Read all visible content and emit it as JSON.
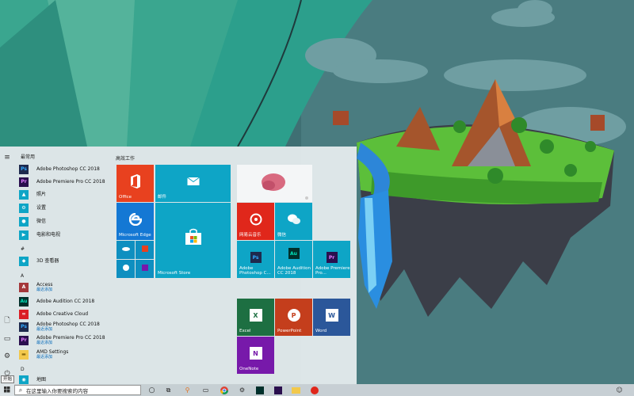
{
  "start_menu": {
    "sections": {
      "recent": "最常用",
      "hash": "#",
      "a": "A",
      "d": "D"
    },
    "recent_apps": [
      {
        "label": "Adobe Photoshop CC 2018",
        "icon": "photoshop-icon"
      },
      {
        "label": "Adobe Premiere Pro CC 2018",
        "icon": "premiere-icon"
      },
      {
        "label": "照片",
        "icon": "photos-icon"
      },
      {
        "label": "设置",
        "icon": "gear-icon"
      },
      {
        "label": "微信",
        "icon": "wechat-icon"
      },
      {
        "label": "电影和电视",
        "icon": "movies-icon"
      }
    ],
    "hash_apps": [
      {
        "label": "3D 查看器",
        "icon": "3d-viewer-icon"
      }
    ],
    "a_apps": [
      {
        "label": "Access",
        "sub": "最近添加",
        "icon": "access-icon"
      },
      {
        "label": "Adobe Audition CC 2018",
        "icon": "audition-icon"
      },
      {
        "label": "Adobe Creative Cloud",
        "icon": "creative-cloud-icon"
      },
      {
        "label": "Adobe Photoshop CC 2018",
        "sub": "最近添加",
        "icon": "photoshop-icon"
      },
      {
        "label": "Adobe Premiere Pro CC 2018",
        "sub": "最近添加",
        "icon": "premiere-icon"
      },
      {
        "label": "AMD Settings",
        "sub": "最近添加",
        "icon": "folder-icon"
      }
    ],
    "d_apps": [
      {
        "label": "地图",
        "icon": "maps-icon"
      }
    ],
    "tiles_header": "高效工作",
    "tiles": {
      "office": "Office",
      "mail": "邮件",
      "edge": "Microsoft Edge",
      "store": "Microsoft Store",
      "netease": "网易云音乐",
      "wechat": "微信",
      "photoshop": "Adobe Photoshop C...",
      "audition": "Adobe Audition CC 2018",
      "premiere": "Adobe Premiere Pro...",
      "excel": "Excel",
      "powerpoint": "PowerPoint",
      "word": "Word",
      "onenote": "OneNote",
      "ps_abbr": "Ps",
      "au_abbr": "Au",
      "pr_abbr": "Pr",
      "xl_abbr": "X",
      "pp_abbr": "P",
      "w_abbr": "W",
      "on_abbr": "N"
    }
  },
  "taskbar": {
    "search_placeholder": "在这里输入你要搜索的内容",
    "start_tooltip": "开始"
  },
  "colors": {
    "accent": "#0ea5c6",
    "office_red": "#e8411f",
    "edge_blue": "#1478d4",
    "adobe_dark": "#1e2a4e",
    "excel_green": "#1d6f42",
    "ppt_orange": "#c43e1c",
    "word_blue": "#2b579a",
    "onenote_purple": "#7719aa"
  }
}
